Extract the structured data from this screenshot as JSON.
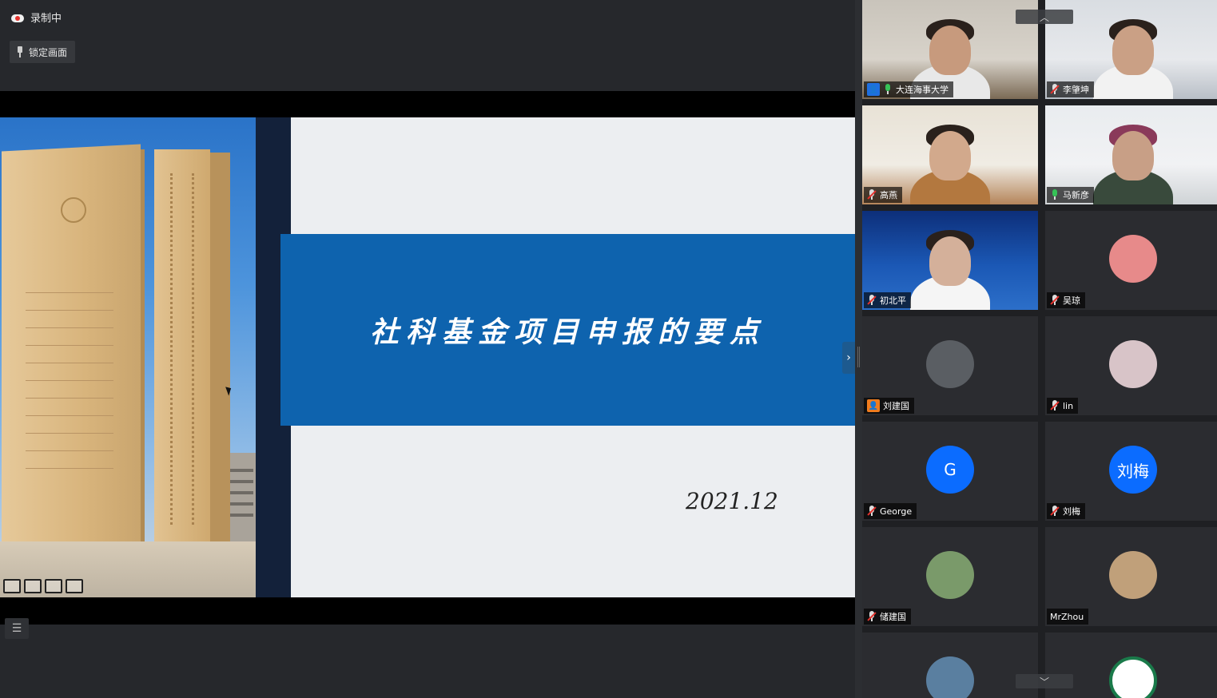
{
  "recording": {
    "label": "录制中"
  },
  "lock_view": {
    "label": "锁定画面"
  },
  "slide": {
    "title": "社科基金项目申报的要点",
    "date": "2021.12"
  },
  "participants": [
    {
      "name": "大连海事大学",
      "mic": "on",
      "type": "video",
      "active": true,
      "badge": "user-icon"
    },
    {
      "name": "李肇坤",
      "mic": "muted",
      "type": "video"
    },
    {
      "name": "高燕",
      "mic": "muted",
      "type": "video"
    },
    {
      "name": "马新彦",
      "mic": "on",
      "type": "video"
    },
    {
      "name": "初北平",
      "mic": "muted",
      "type": "video"
    },
    {
      "name": "吴琼",
      "mic": "muted",
      "type": "avatar"
    },
    {
      "name": "刘建国",
      "mic": "none",
      "type": "avatar",
      "badge": "user-icon"
    },
    {
      "name": "lin",
      "mic": "muted",
      "type": "avatar"
    },
    {
      "name": "George",
      "mic": "muted",
      "type": "initial",
      "initial": "G"
    },
    {
      "name": "刘梅",
      "mic": "muted",
      "type": "initial",
      "initial": "刘梅"
    },
    {
      "name": "储建国",
      "mic": "muted",
      "type": "avatar"
    },
    {
      "name": "MrZhou",
      "mic": "none",
      "type": "avatar"
    },
    {
      "name": "",
      "mic": "none",
      "type": "avatar"
    },
    {
      "name": "",
      "mic": "none",
      "type": "avatar"
    }
  ],
  "colors": {
    "accent": "#1e6fe0",
    "active_border": "#2ea84f",
    "banner": "#0e63ae",
    "initial_bg": "#0b6cff"
  }
}
